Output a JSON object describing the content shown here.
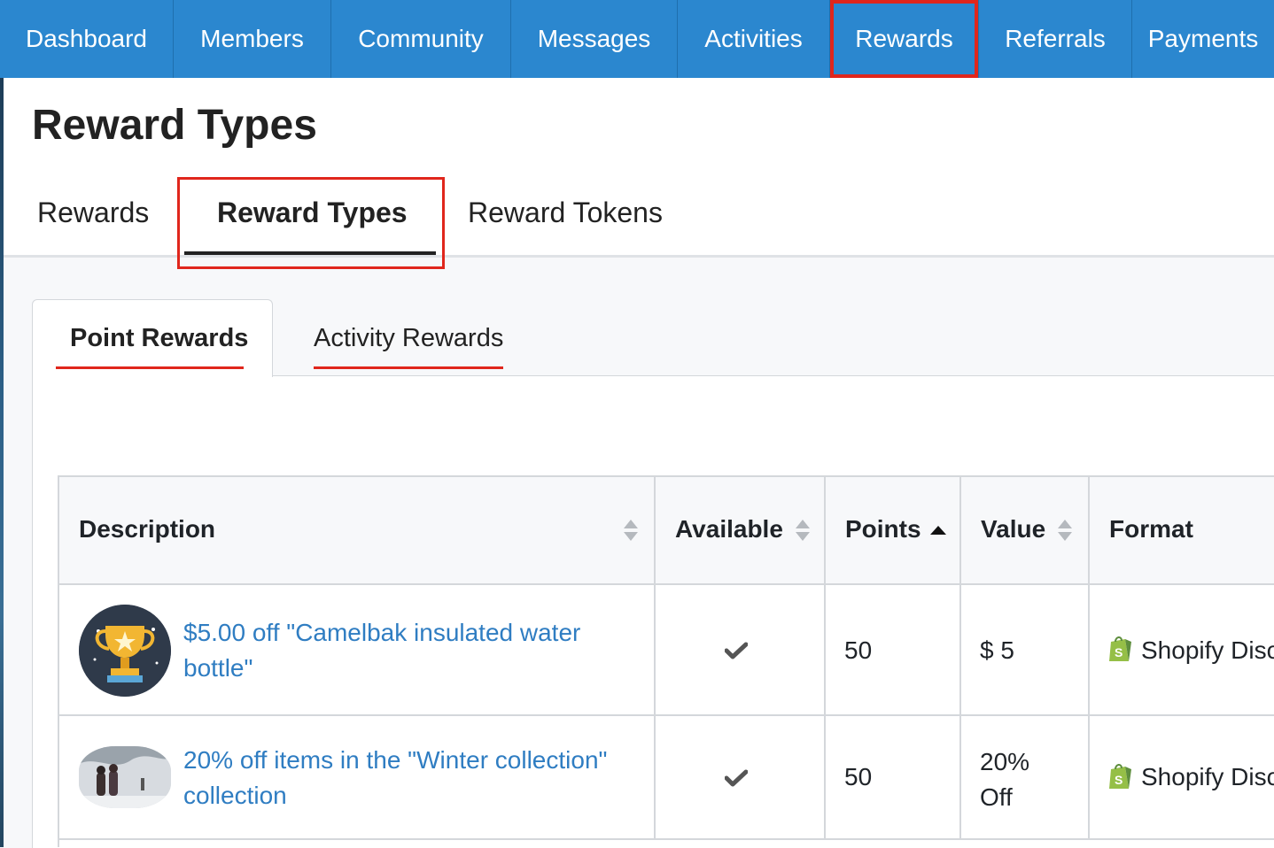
{
  "nav": {
    "items": [
      "Dashboard",
      "Members",
      "Community",
      "Messages",
      "Activities",
      "Rewards",
      "Referrals",
      "Payments"
    ],
    "active": "Rewards"
  },
  "page": {
    "title": "Reward Types"
  },
  "tabs": {
    "items": [
      "Rewards",
      "Reward Types",
      "Reward Tokens"
    ],
    "selected": "Reward Types"
  },
  "subtabs": {
    "items": [
      "Point Rewards",
      "Activity Rewards"
    ],
    "selected": "Point Rewards"
  },
  "table": {
    "headers": [
      "Description",
      "Available",
      "Points",
      "Value",
      "Format"
    ],
    "sort": {
      "column": "Points",
      "direction": "ascending"
    },
    "rows": [
      {
        "image": "trophy-icon",
        "description_line1": "$5.00 off \"Camelbak insulated water",
        "description_line2": "bottle\"",
        "available": true,
        "points": "50",
        "value_line1": "$ 5",
        "value_line2": "",
        "format": "Shopify Disc"
      },
      {
        "image": "winter-photo",
        "description_line1": "20% off items in the \"Winter collection\"",
        "description_line2": "collection",
        "available": true,
        "points": "50",
        "value_line1": "20%",
        "value_line2": "Off",
        "format": "Shopify Disc"
      }
    ]
  },
  "colors": {
    "nav_bg": "#2b87cf",
    "highlight_red": "#e0261c",
    "link_blue": "#2f7dc2",
    "shopify_green": "#95bf47"
  }
}
